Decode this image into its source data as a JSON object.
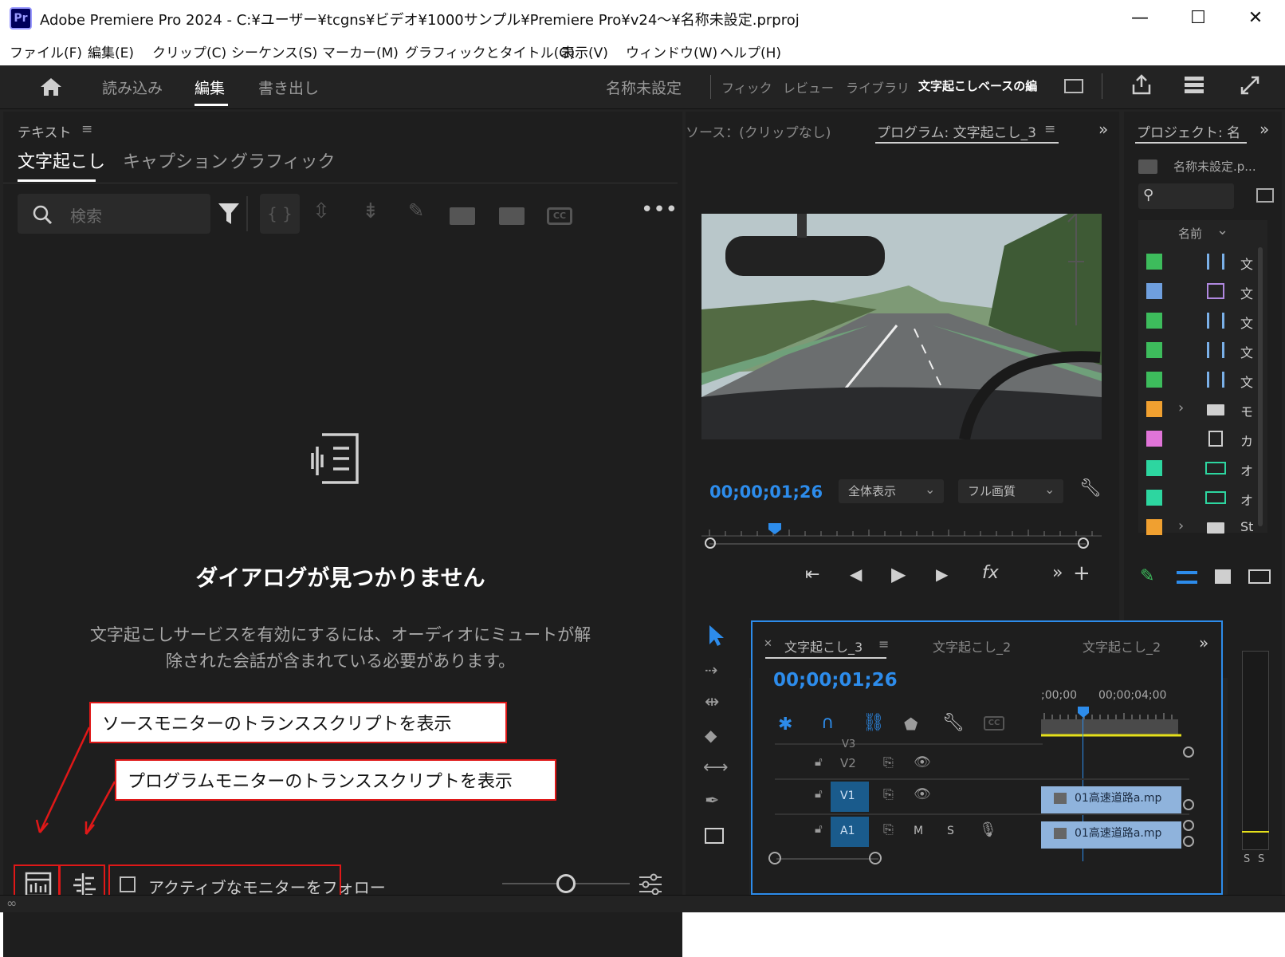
{
  "window": {
    "title": "Adobe Premiere Pro 2024 - C:¥ユーザー¥tcgns¥ビデオ¥1000サンプル¥Premiere Pro¥v24～¥名称未設定.prproj",
    "app_icon": "Pr",
    "minimize": "—",
    "maximize": "☐",
    "close": "✕"
  },
  "menu": [
    "ファイル(F)",
    "編集(E)",
    "クリップ(C)",
    "シーケンス(S)",
    "マーカー(M)",
    "グラフィックとタイトル(G)",
    "表示(V)",
    "ウィンドウ(W)",
    "ヘルプ(H)"
  ],
  "workspace": {
    "tabs": [
      "読み込み",
      "編集",
      "書き出し"
    ],
    "active_tab": "編集",
    "project_name": "名称未設定",
    "right_tabs": [
      "フィック",
      "レビュー",
      "ライブラリ",
      "文字起こしベースの編"
    ]
  },
  "text_panel": {
    "header": "テキスト",
    "tabs": [
      "文字起こし",
      "キャプション",
      "グラフィック"
    ],
    "search_placeholder": "検索",
    "empty_title": "ダイアログが見つかりません",
    "empty_body_line1": "文字起こしサービスを有効にするには、オーディオにミュートが解",
    "empty_body_line2": "除された会話が含まれている必要があります。",
    "follow_monitor_label": "アクティブなモニターをフォロー"
  },
  "callouts": {
    "source": "ソースモニターのトランススクリプトを表示",
    "program": "プログラムモニターのトランススクリプトを表示"
  },
  "monitor": {
    "source_tab": "ソース：(クリップなし)",
    "program_tab": "プログラム: 文字起こし_3",
    "timecode": "00;00;01;26",
    "zoom_select": "全体表示",
    "quality_select": "フル画質"
  },
  "project_panel": {
    "header": "プロジェクト: 名",
    "project_file": "名称未設定.p...",
    "column_name": "名前",
    "items": [
      {
        "color": "#3dbc5c",
        "icon": "sequence-icon",
        "name": "文"
      },
      {
        "color": "#6f9fde",
        "icon": "multicam-icon",
        "name": "文"
      },
      {
        "color": "#3dbc5c",
        "icon": "sequence-icon",
        "name": "文"
      },
      {
        "color": "#3dbc5c",
        "icon": "sequence-icon",
        "name": "文"
      },
      {
        "color": "#3dbc5c",
        "icon": "sequence-icon",
        "name": "文"
      },
      {
        "color": "#f0a030",
        "icon": "folder-icon",
        "name": "モ"
      },
      {
        "color": "#e074d8",
        "icon": "graphic-icon",
        "name": "カ"
      },
      {
        "color": "#2dd6a0",
        "icon": "audio-icon",
        "name": "オ"
      },
      {
        "color": "#2dd6a0",
        "icon": "audio-icon",
        "name": "オ"
      },
      {
        "color": "#f0a030",
        "icon": "folder-icon",
        "name": "St"
      }
    ]
  },
  "timeline": {
    "tabs": [
      "文字起こし_3",
      "文字起こし_2",
      "文字起こし_2"
    ],
    "timecode": "00;00;01;26",
    "ruler_labels": [
      ";00;00",
      "00;00;04;00"
    ],
    "tracks": [
      {
        "name": "V3"
      },
      {
        "name": "V2"
      },
      {
        "name": "V1",
        "clip": "01高速道路a.mp"
      },
      {
        "name": "A1",
        "clip": "01高速道路a.mp",
        "m": "M",
        "s": "S"
      }
    ],
    "audio_meter_labels": [
      "S",
      "S"
    ]
  },
  "colors": {
    "accent_blue": "#2d8ceb",
    "callout_red": "#e01818",
    "active_track": "#1a5b8c"
  }
}
